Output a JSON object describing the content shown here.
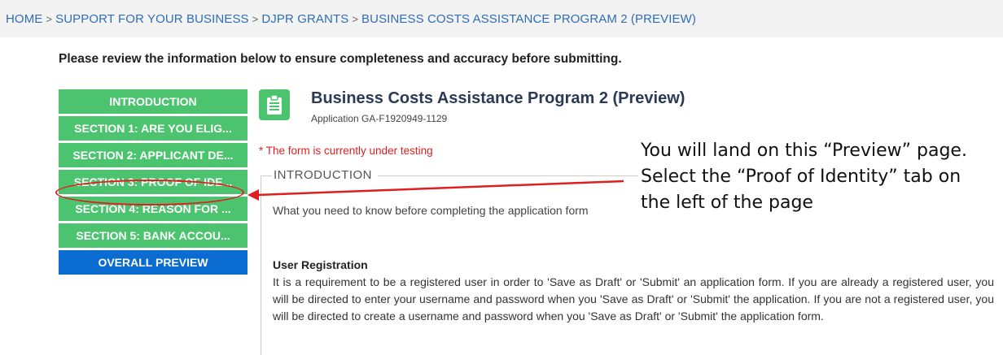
{
  "breadcrumb": {
    "items": [
      "HOME",
      "SUPPORT FOR YOUR BUSINESS",
      "DJPR GRANTS",
      "BUSINESS COSTS ASSISTANCE PROGRAM 2 (PREVIEW)"
    ],
    "separator": ">"
  },
  "review_instruction": "Please review the information below to ensure completeness and accuracy before submitting.",
  "sidebar": {
    "items": [
      {
        "label": "INTRODUCTION"
      },
      {
        "label": "SECTION 1: ARE YOU ELIG..."
      },
      {
        "label": "SECTION 2: APPLICANT DE..."
      },
      {
        "label": "SECTION 3: PROOF OF IDE..."
      },
      {
        "label": "SECTION 4: REASON FOR ..."
      },
      {
        "label": "SECTION 5: BANK ACCOU..."
      },
      {
        "label": "OVERALL PREVIEW"
      }
    ],
    "active_color": "#4cc46f",
    "overall_color": "#0a6bd1"
  },
  "form": {
    "icon": "clipboard-form-icon",
    "title": "Business Costs Assistance Program 2 (Preview)",
    "application_id": "Application GA-F1920949-1129",
    "testing_note": "* The form is currently under testing",
    "section_legend": "INTRODUCTION",
    "intro_text": "What you need to know before completing the application form"
  },
  "callout": {
    "line1": "You will land on this “Preview” page.",
    "line2": "Select the “Proof of Identity” tab on",
    "line3": "the left of the page",
    "arrow_color": "#e01e1e"
  },
  "registration": {
    "heading": "User Registration",
    "body": "It is a requirement to be a registered user in order to 'Save as Draft' or 'Submit' an application form. If you are already a registered user, you will be directed to enter your username and password when you 'Save as Draft' or 'Submit' the application. If you are not a registered user, you will be directed to create a username and password when you 'Save as Draft' or 'Submit' the application form."
  }
}
